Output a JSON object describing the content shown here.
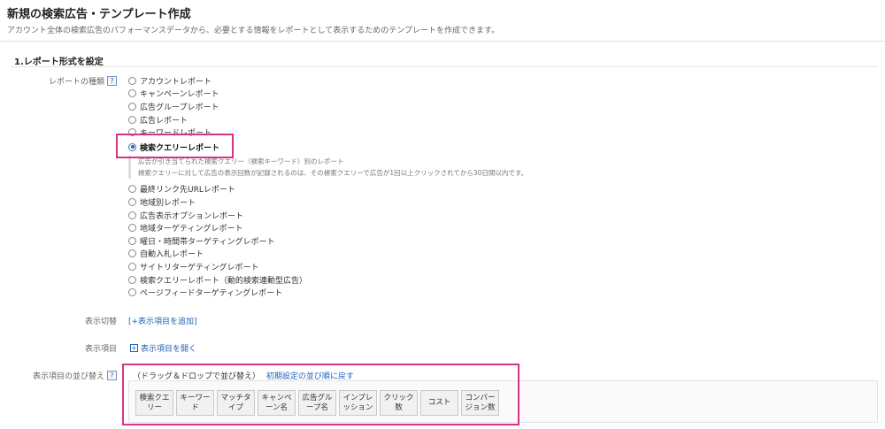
{
  "header": {
    "title": "新規の検索広告・テンプレート作成",
    "description": "アカウント全体の検索広告のパフォーマンスデータから、必要とする情報をレポートとして表示するためのテンプレートを作成できます。"
  },
  "section1": {
    "title": "1.レポート形式を設定",
    "report_type_label": "レポートの種類",
    "help": "?",
    "report_types": [
      "アカウントレポート",
      "キャンペーンレポート",
      "広告グループレポート",
      "広告レポート",
      "キーワードレポート",
      "検索クエリーレポート",
      "最終リンク先URLレポート",
      "地域別レポート",
      "広告表示オプションレポート",
      "地域ターゲティングレポート",
      "曜日・時間帯ターゲティングレポート",
      "自動入札レポート",
      "サイトリターゲティングレポート",
      "検索クエリーレポート（動的検索連動型広告）",
      "ページフィードターゲティングレポート"
    ],
    "selected_index": 5,
    "selected_notes": [
      "広告が引き当てられた検索クエリー（検索キーワード）別のレポート",
      "検索クエリーに対して広告の表示回数が記録されるのは、その検索クエリーで広告が1回以上クリックされてから30日間以内です。"
    ],
    "display_toggle_label": "表示切替",
    "display_toggle_link": "[+表示項目を追加]",
    "display_items_label": "表示項目",
    "display_items_plus": "+",
    "display_items_link": "表示項目を開く",
    "sort_label": "表示項目の並び替え",
    "sort_hint": "（ドラッグ＆ドロップで並び替え）",
    "sort_reset_link": "初期設定の並び順に戻す",
    "sort_columns": [
      "検索クエ\nリー",
      "キーワー\nド",
      "マッチタ\nイプ",
      "キャンペ\nーン名",
      "広告グル\nープ名",
      "インプレ\nッション",
      "クリック\n数",
      "コスト",
      "コンバー\nジョン数"
    ]
  },
  "colors": {
    "highlight": "#d63384",
    "link": "#1f63b5"
  }
}
